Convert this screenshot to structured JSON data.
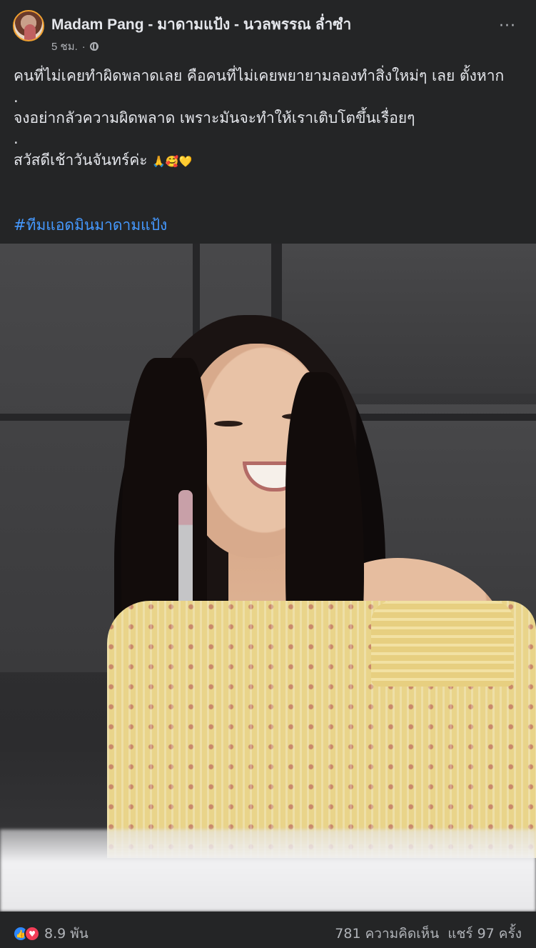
{
  "post": {
    "author": "Madam Pang - มาดามแป้ง - นวลพรรณ ล่ำซำ",
    "timestamp": "5 ชม.",
    "meta_separator": "·",
    "more_label": "···",
    "text": {
      "line1": "คนที่ไม่เคยทำผิดพลาดเลย คือคนที่ไม่เคยพยายามลองทำสิ่งใหม่ๆ เลย ตั้งหาก",
      "dot1": ".",
      "line2": "จงอย่ากลัวความผิดพลาด เพราะมันจะทำให้เราเติบโตขึ้นเรื่อยๆ",
      "dot2": ".",
      "line3": "สวัสดีเช้าวันจันทร์ค่ะ",
      "emojis": "🙏🥰💛"
    },
    "hashtag": "#ทีมแอดมินมาดามแป้ง"
  },
  "footer": {
    "reaction_count": "8.9 พัน",
    "comments": "781 ความคิดเห็น",
    "shares": "แชร์ 97 ครั้ง"
  },
  "colors": {
    "background": "#242526",
    "text": "#e4e6eb",
    "muted": "#b0b3b8",
    "link": "#4599ff",
    "like": "#2d88ff",
    "love": "#f33e58"
  },
  "icons": {
    "privacy": "globe-icon",
    "more": "more-options-icon",
    "reaction_like": "like-icon",
    "reaction_love": "love-icon"
  }
}
